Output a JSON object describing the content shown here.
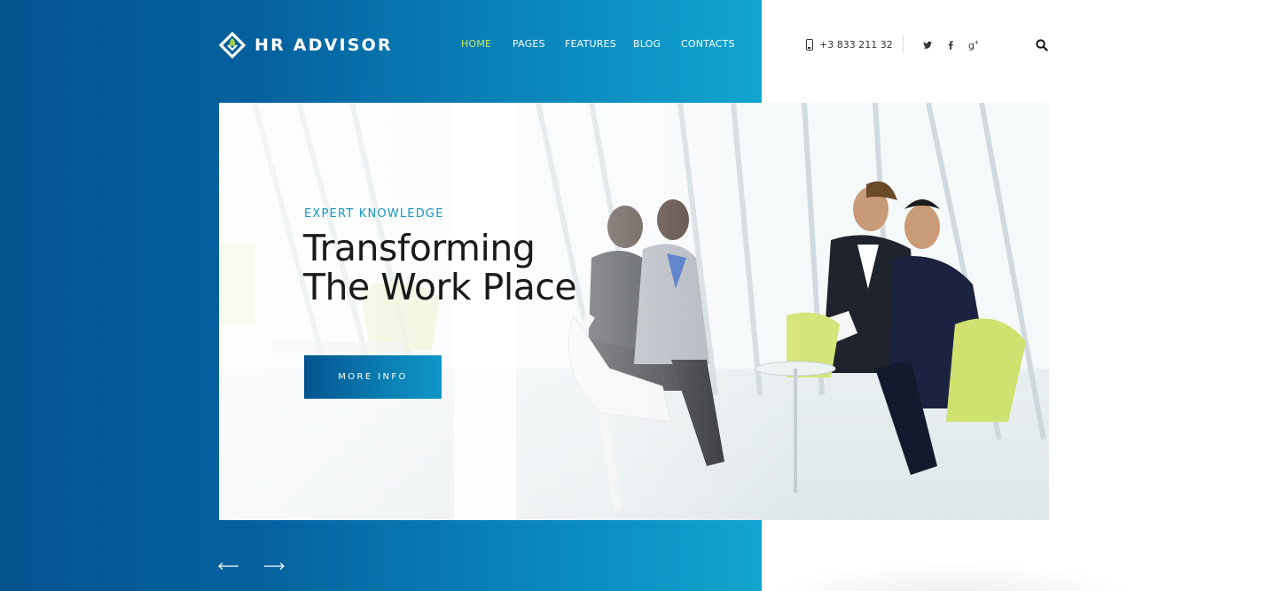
{
  "brand": {
    "name": "HR ADVISOR"
  },
  "nav": {
    "items": [
      {
        "label": "HOME",
        "active": true
      },
      {
        "label": "PAGES",
        "active": false
      },
      {
        "label": "FEATURES",
        "active": false
      },
      {
        "label": "BLOG",
        "active": false
      },
      {
        "label": "CONTACTS",
        "active": false
      }
    ]
  },
  "contact": {
    "phone": "+3 833 211 32"
  },
  "social": {
    "icons": [
      "twitter-icon",
      "facebook-icon",
      "google-plus-icon"
    ]
  },
  "hero": {
    "eyebrow": "EXPERT KNOWLEDGE",
    "headline_line1": "Transforming",
    "headline_line2": "The Work Place",
    "cta_label": "MORE INFO"
  },
  "slider": {
    "prev_icon": "arrow-left-icon",
    "next_icon": "arrow-right-icon"
  },
  "colors": {
    "primary_dark": "#03548f",
    "primary_light": "#11a5cf",
    "nav_active": "#c9e86a",
    "eyebrow": "#1795c2",
    "logo_accent": "#a9d04a"
  }
}
